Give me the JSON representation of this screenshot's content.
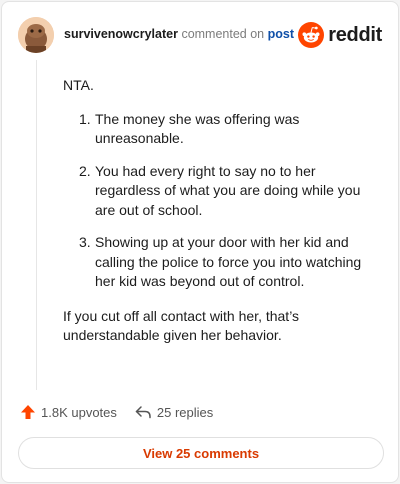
{
  "header": {
    "username": "survivenowcrylater",
    "action_text": "commented on",
    "link_text": "post",
    "brand_name": "reddit"
  },
  "comment": {
    "intro": "NTA.",
    "points": [
      {
        "number": "1.",
        "text": "The money she was offering was unreasonable."
      },
      {
        "number": "2.",
        "text": "You had every right to say no to her regardless of what you are doing while you are out of school."
      },
      {
        "number": "3.",
        "text": "Showing up at your door with her kid and calling the police to force you into watching her kid was beyond out of control."
      }
    ],
    "outro": "If you cut off all contact with her, that’s understandable given her behavior."
  },
  "actions": {
    "upvotes": "1.8K upvotes",
    "replies": "25 replies"
  },
  "view_comments_label": "View 25 comments",
  "colors": {
    "brand_orange": "#ff4500",
    "link_blue": "#0f4fa8",
    "button_text": "#d93a00"
  },
  "icons": {
    "upvote": "arrow-up-icon",
    "reply": "reply-arrow-icon",
    "brand": "reddit-snoo-icon"
  }
}
